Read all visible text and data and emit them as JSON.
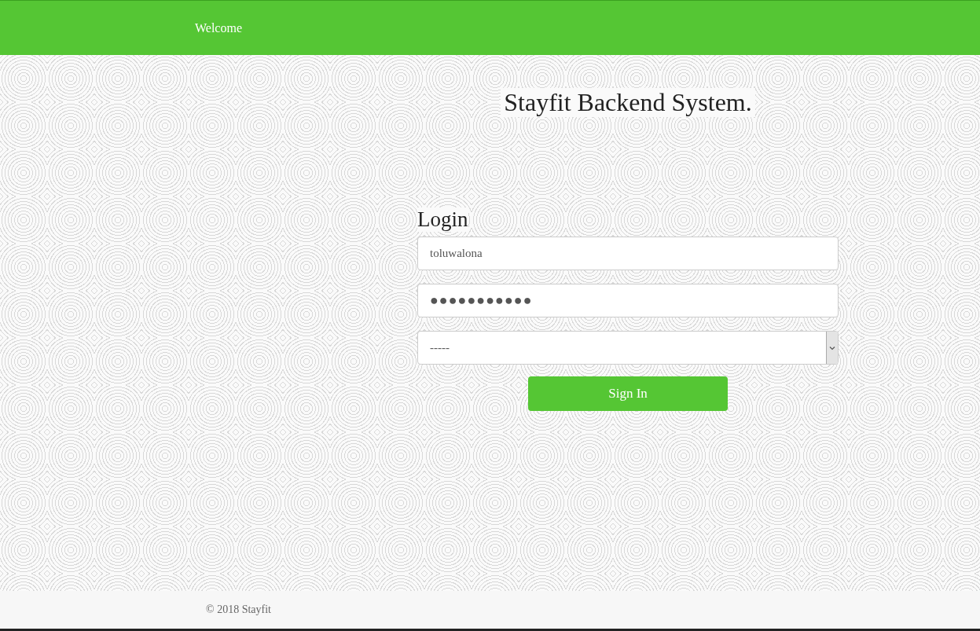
{
  "navbar": {
    "brand": "Welcome"
  },
  "heading": "Stayfit Backend System.",
  "login": {
    "title": "Login",
    "username": {
      "value": "toluwalona"
    },
    "password": {
      "value": "●●●●●●●●●●●"
    },
    "role_select": {
      "value": "-----"
    },
    "submit": "Sign In"
  },
  "footer": {
    "text": "© 2018 Stayfit"
  }
}
